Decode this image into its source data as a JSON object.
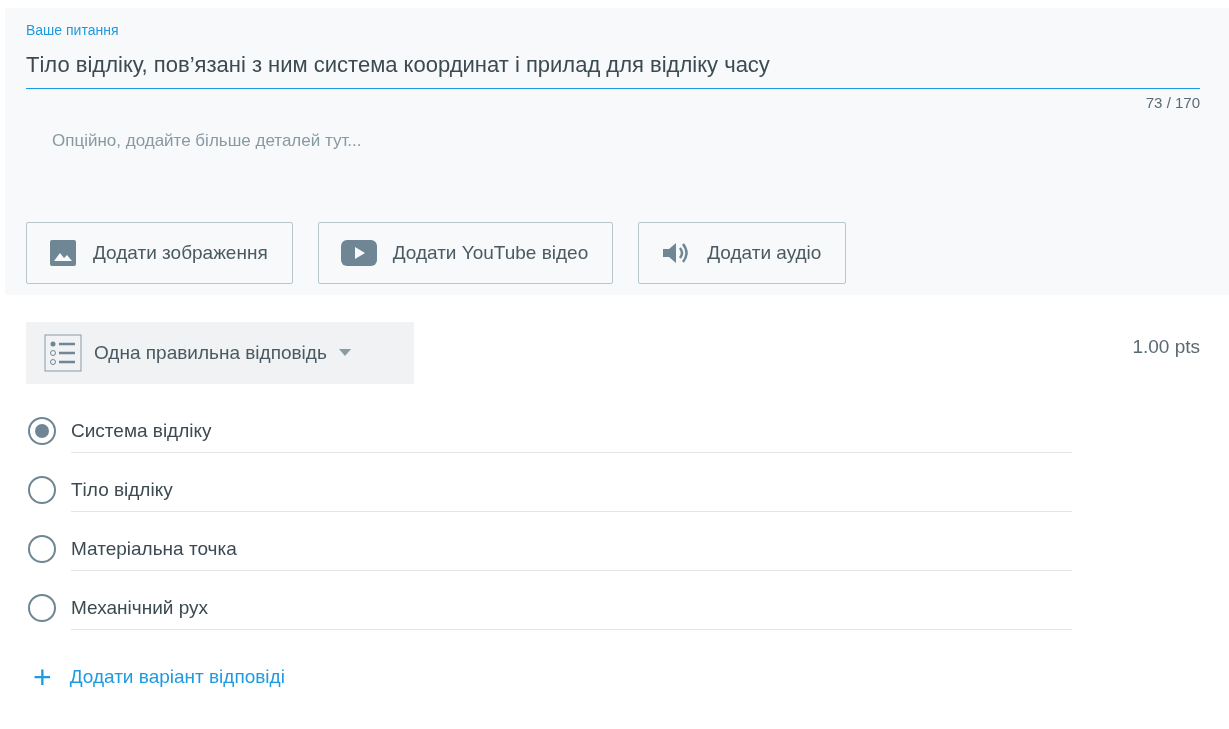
{
  "question": {
    "label": "Ваше питання",
    "value": "Тіло відліку, пов’язані з ним система координат і прилад для відліку часу",
    "counter": "73 / 170"
  },
  "details": {
    "placeholder": "Опційно, додайте більше деталей тут..."
  },
  "media_buttons": [
    {
      "kind": "image",
      "label": "Додати зображення"
    },
    {
      "kind": "video",
      "label": "Додати YouTube відео"
    },
    {
      "kind": "audio",
      "label": "Додати аудіо"
    }
  ],
  "answer_type": {
    "label": "Одна правильна відповідь"
  },
  "points": "1.00 pts",
  "options": [
    {
      "label": "Система відліку",
      "selected": true
    },
    {
      "label": "Тіло відліку",
      "selected": false
    },
    {
      "label": "Матеріальна точка",
      "selected": false
    },
    {
      "label": "Механічний рух",
      "selected": false
    }
  ],
  "add_option": {
    "icon": "+",
    "label": "Додати варіант відповіді"
  }
}
